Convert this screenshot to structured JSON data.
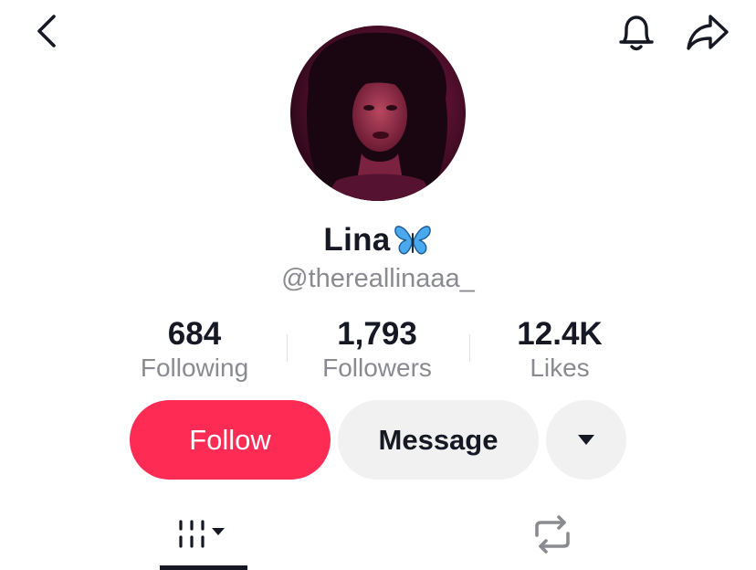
{
  "header": {
    "back_icon": "chevron-left-icon",
    "bell_icon": "bell-icon",
    "share_icon": "share-arrow-icon"
  },
  "profile": {
    "name": "Lina",
    "name_emoji": "butterfly-icon",
    "handle": "@thereallinaaa_"
  },
  "stats": [
    {
      "value": "684",
      "label": "Following"
    },
    {
      "value": "1,793",
      "label": "Followers"
    },
    {
      "value": "12.4K",
      "label": "Likes"
    }
  ],
  "actions": {
    "follow_label": "Follow",
    "message_label": "Message",
    "more_icon": "caret-down-icon"
  },
  "tabs": [
    {
      "icon": "videos-grid-icon",
      "active": true
    },
    {
      "icon": "repost-icon",
      "active": false
    }
  ],
  "colors": {
    "accent": "#fe2c55",
    "secondary_button": "#f1f1f2",
    "muted_text": "#8a8b91",
    "butterfly": "#4aa8ee"
  }
}
